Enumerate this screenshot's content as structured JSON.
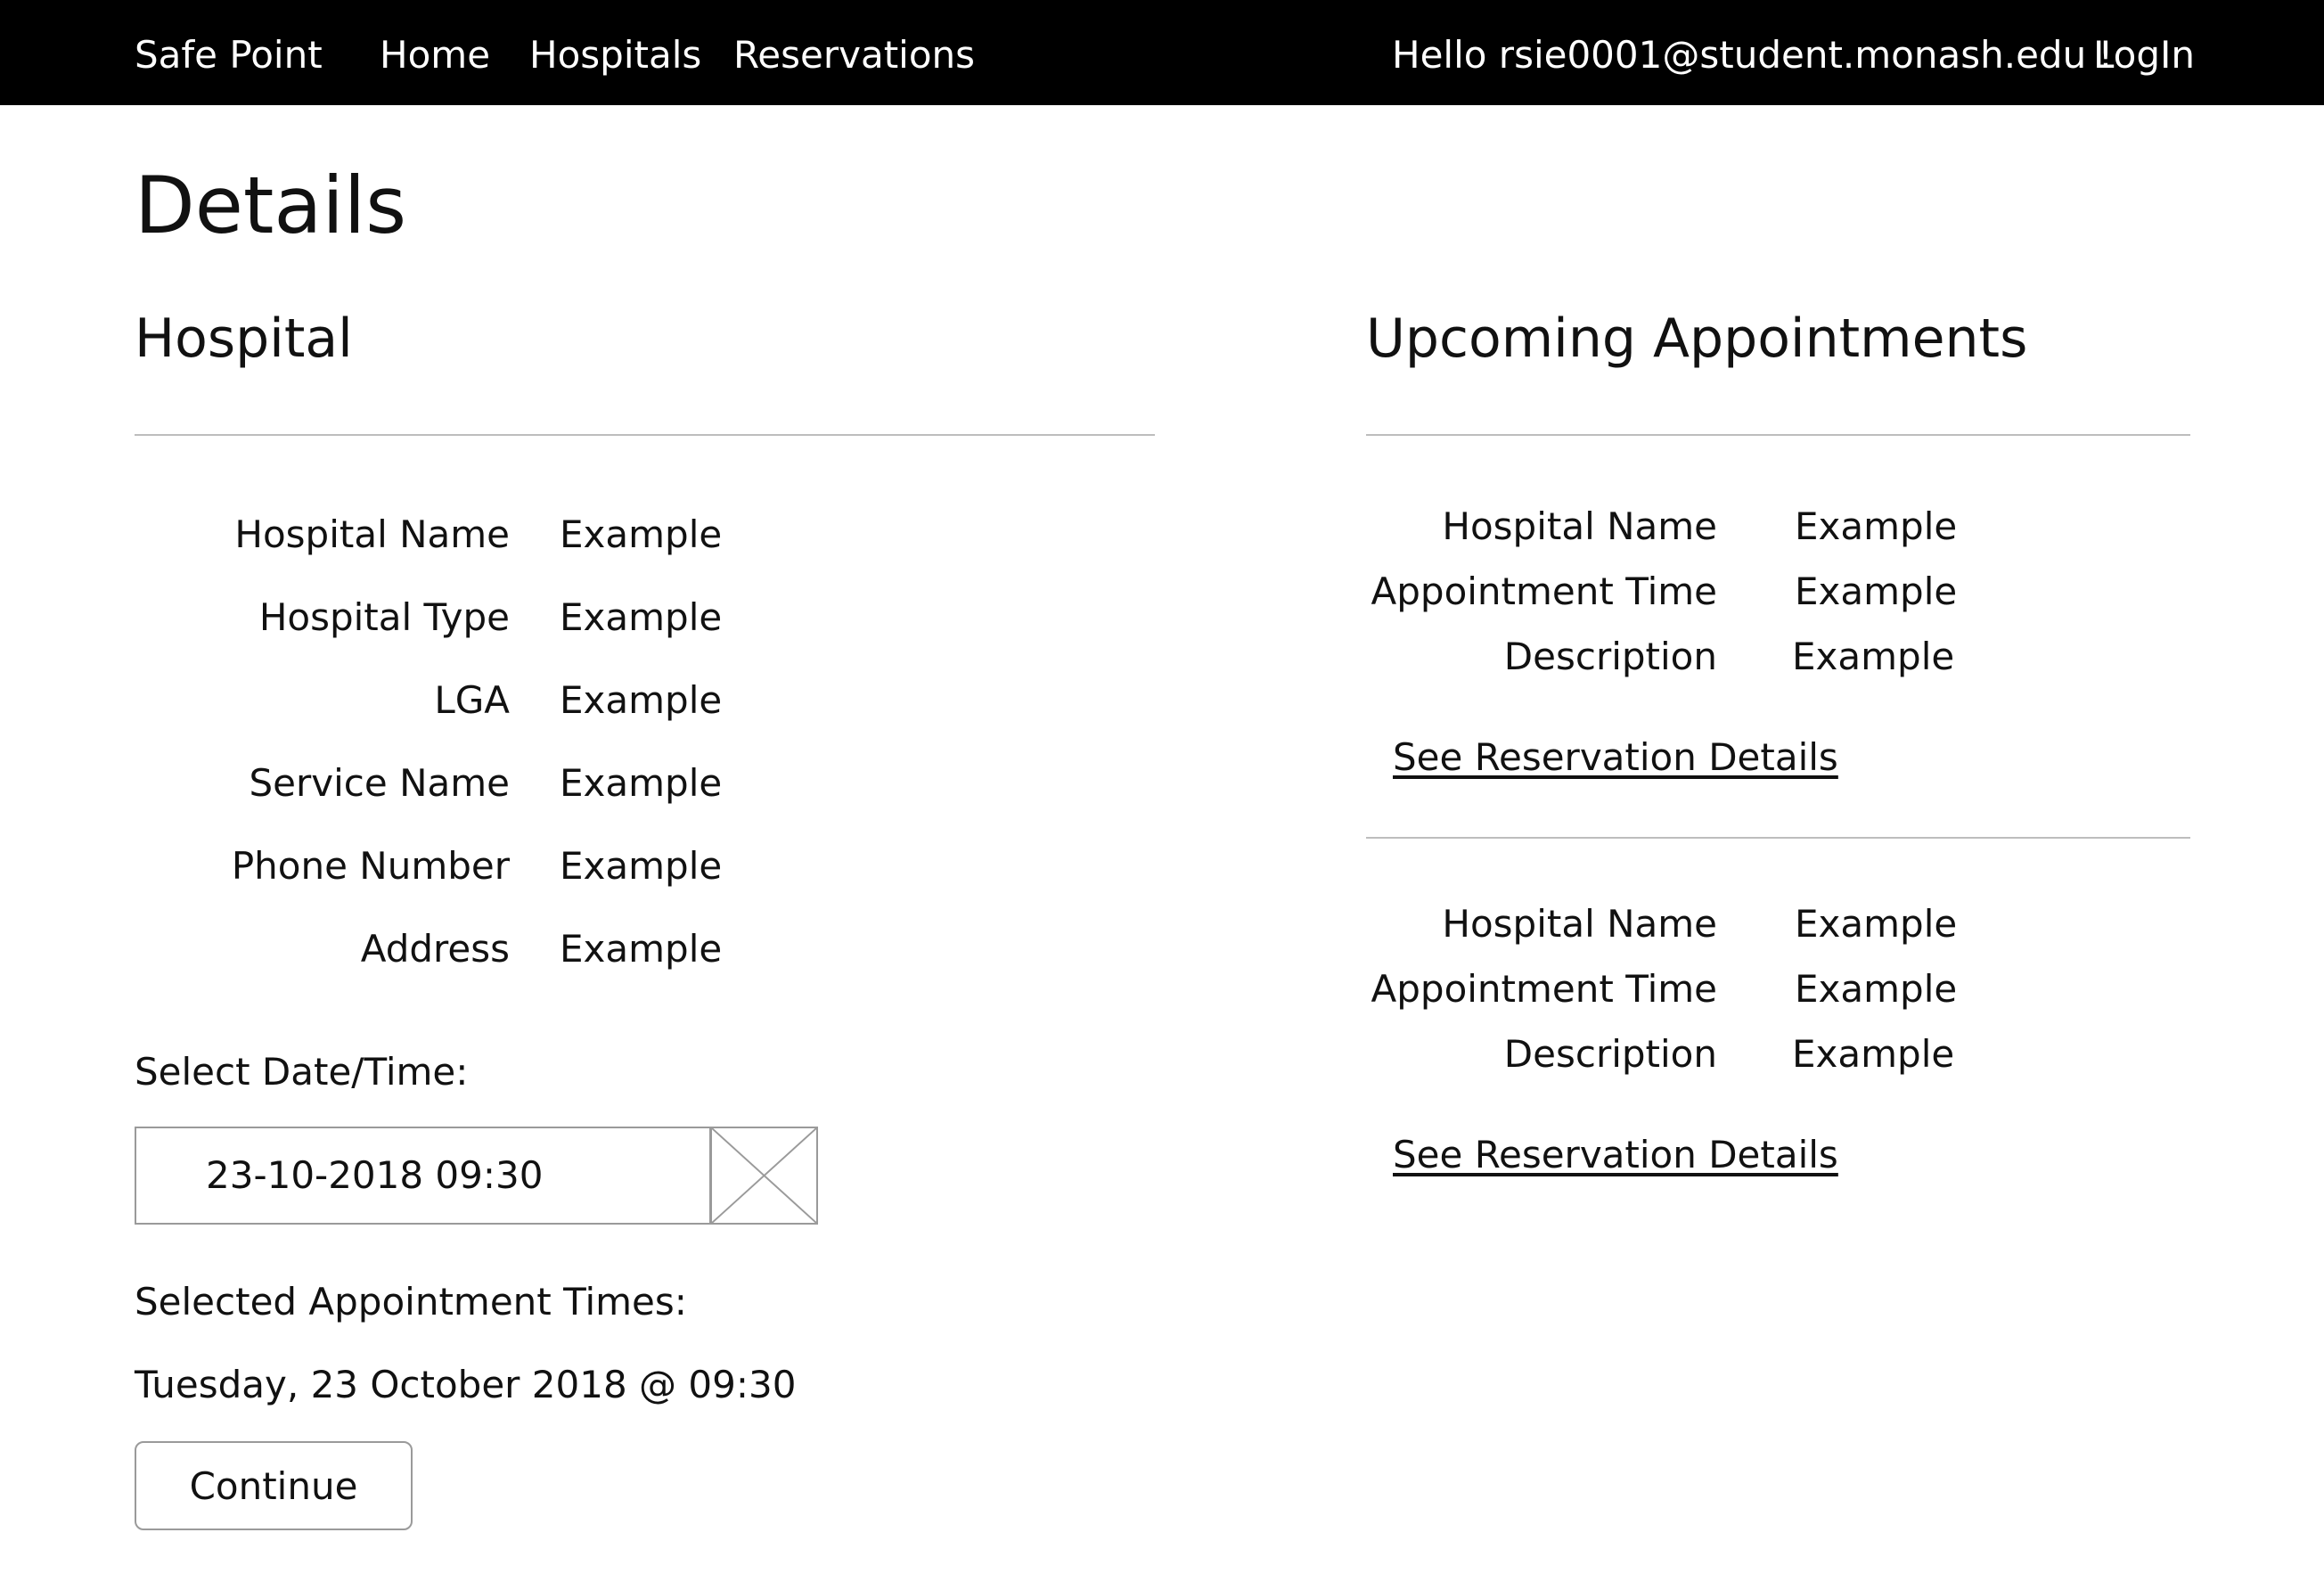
{
  "navbar": {
    "brand": "Safe Point",
    "links": [
      "Home",
      "Hospitals",
      "Reservations"
    ],
    "greeting": "Hello rsie0001@student.monash.edu !",
    "login": "LogIn"
  },
  "page": {
    "title": "Details"
  },
  "hospital": {
    "title": "Hospital",
    "fields": [
      {
        "label": "Hospital Name",
        "value": "Example"
      },
      {
        "label": "Hospital Type",
        "value": "Example"
      },
      {
        "label": "LGA",
        "value": "Example"
      },
      {
        "label": "Service Name",
        "value": "Example"
      },
      {
        "label": "Phone Number",
        "value": "Example"
      },
      {
        "label": "Address",
        "value": "Example"
      }
    ],
    "date_label": "Select Date/Time:",
    "date_value": "23-10-2018 09:30",
    "selected_label": "Selected Appointment Times:",
    "selected_value": "Tuesday, 23 October 2018 @ 09:30",
    "continue_label": "Continue"
  },
  "upcoming": {
    "title": "Upcoming Appointments",
    "appointments": [
      {
        "fields": [
          {
            "label": "Hospital Name",
            "value": "Example"
          },
          {
            "label": "Appointment Time",
            "value": "Example"
          },
          {
            "label": "Description",
            "value": "Example"
          }
        ],
        "link": "See Reservation Details"
      },
      {
        "fields": [
          {
            "label": "Hospital Name",
            "value": "Example"
          },
          {
            "label": "Appointment Time",
            "value": "Example"
          },
          {
            "label": "Description",
            "value": "Example"
          }
        ],
        "link": "See Reservation Details"
      }
    ]
  },
  "colors": {
    "navbar_bg": "#000000",
    "navbar_text": "#ffffff",
    "rule": "#bdbdbd",
    "border": "#9a9a9a"
  }
}
